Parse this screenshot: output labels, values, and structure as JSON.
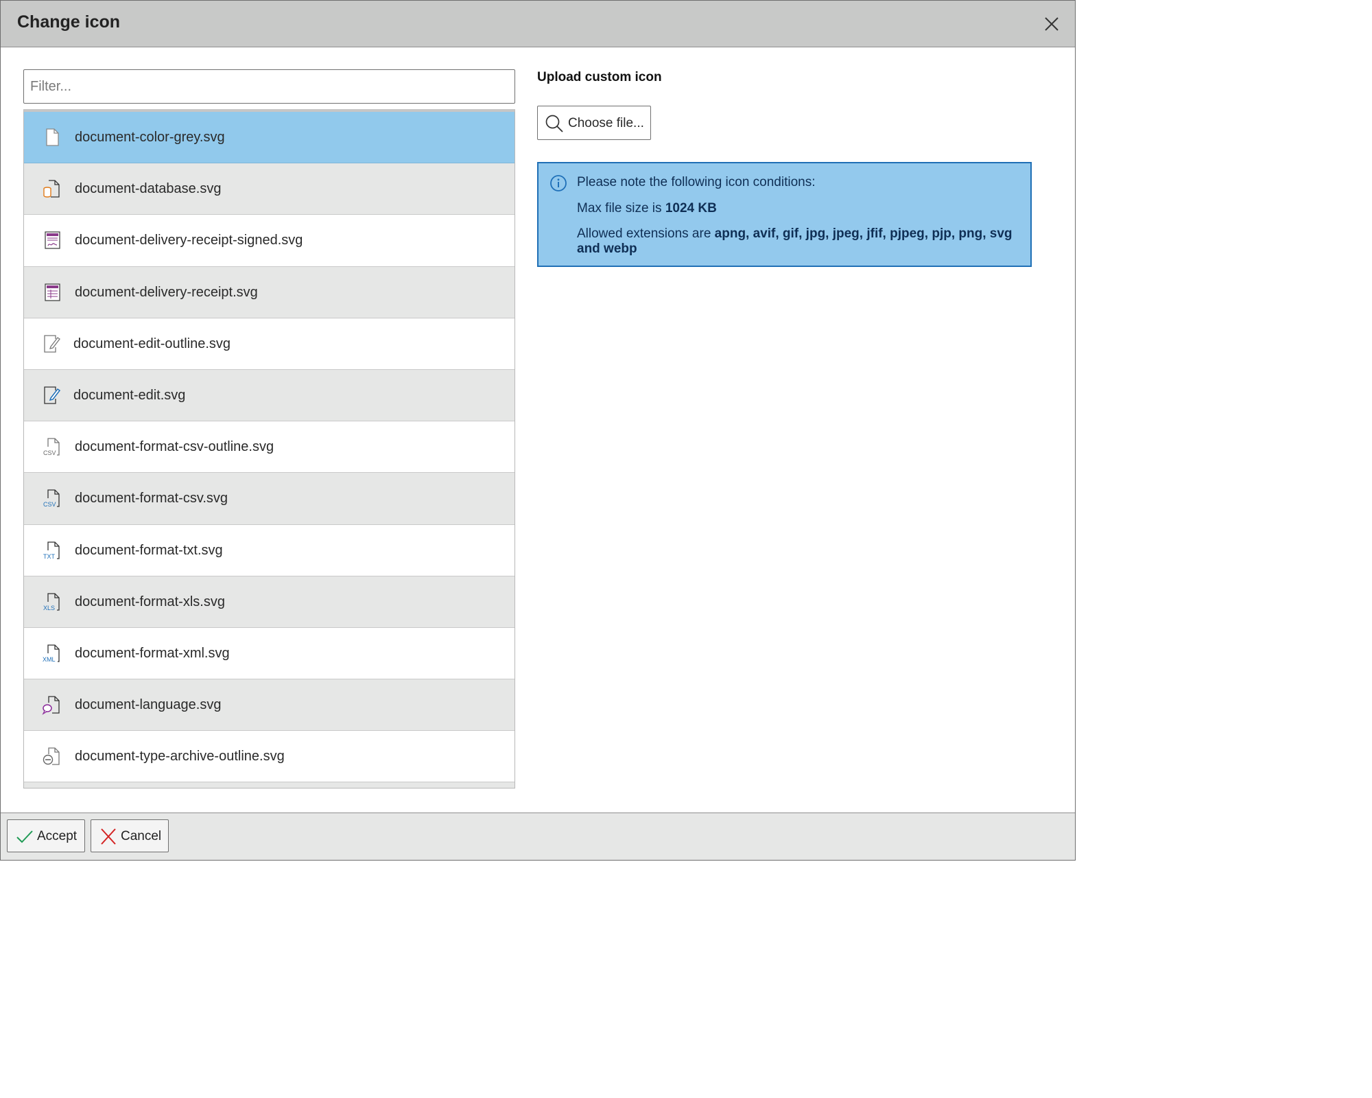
{
  "dialog": {
    "title": "Change icon",
    "close_icon": "close-icon"
  },
  "filter": {
    "placeholder": "Filter...",
    "value": ""
  },
  "icon_list": [
    {
      "label": "document-color-grey.svg",
      "icon": "document-grey-icon",
      "selected": true
    },
    {
      "label": "document-database.svg",
      "icon": "document-database-icon"
    },
    {
      "label": "document-delivery-receipt-signed.svg",
      "icon": "document-delivery-receipt-signed-icon"
    },
    {
      "label": "document-delivery-receipt.svg",
      "icon": "document-delivery-receipt-icon"
    },
    {
      "label": "document-edit-outline.svg",
      "icon": "document-edit-outline-icon"
    },
    {
      "label": "document-edit.svg",
      "icon": "document-edit-icon"
    },
    {
      "label": "document-format-csv-outline.svg",
      "icon": "document-csv-outline-icon"
    },
    {
      "label": "document-format-csv.svg",
      "icon": "document-csv-icon"
    },
    {
      "label": "document-format-txt.svg",
      "icon": "document-txt-icon"
    },
    {
      "label": "document-format-xls.svg",
      "icon": "document-xls-icon"
    },
    {
      "label": "document-format-xml.svg",
      "icon": "document-xml-icon"
    },
    {
      "label": "document-language.svg",
      "icon": "document-language-icon"
    },
    {
      "label": "document-type-archive-outline.svg",
      "icon": "document-archive-outline-icon"
    }
  ],
  "upload": {
    "title": "Upload custom icon",
    "choose_label": "Choose file...",
    "choose_icon": "search-icon"
  },
  "info": {
    "icon": "info-icon",
    "intro": "Please note the following icon conditions:",
    "max_size_prefix": "Max file size is ",
    "max_size_value": "1024 KB",
    "extensions_prefix": "Allowed extensions are ",
    "extensions_value": "apng, avif, gif, jpg, jpeg, jfif, pjpeg, pjp, png, svg and webp"
  },
  "footer": {
    "accept_label": "Accept",
    "cancel_label": "Cancel",
    "accept_icon": "checkmark-icon",
    "cancel_icon": "x-icon"
  },
  "colors": {
    "selected_row": "#91c9ec",
    "info_background": "#93c9ed",
    "info_border": "#1f6fb5",
    "accept_check": "#1e9a54",
    "cancel_x": "#d32222"
  }
}
